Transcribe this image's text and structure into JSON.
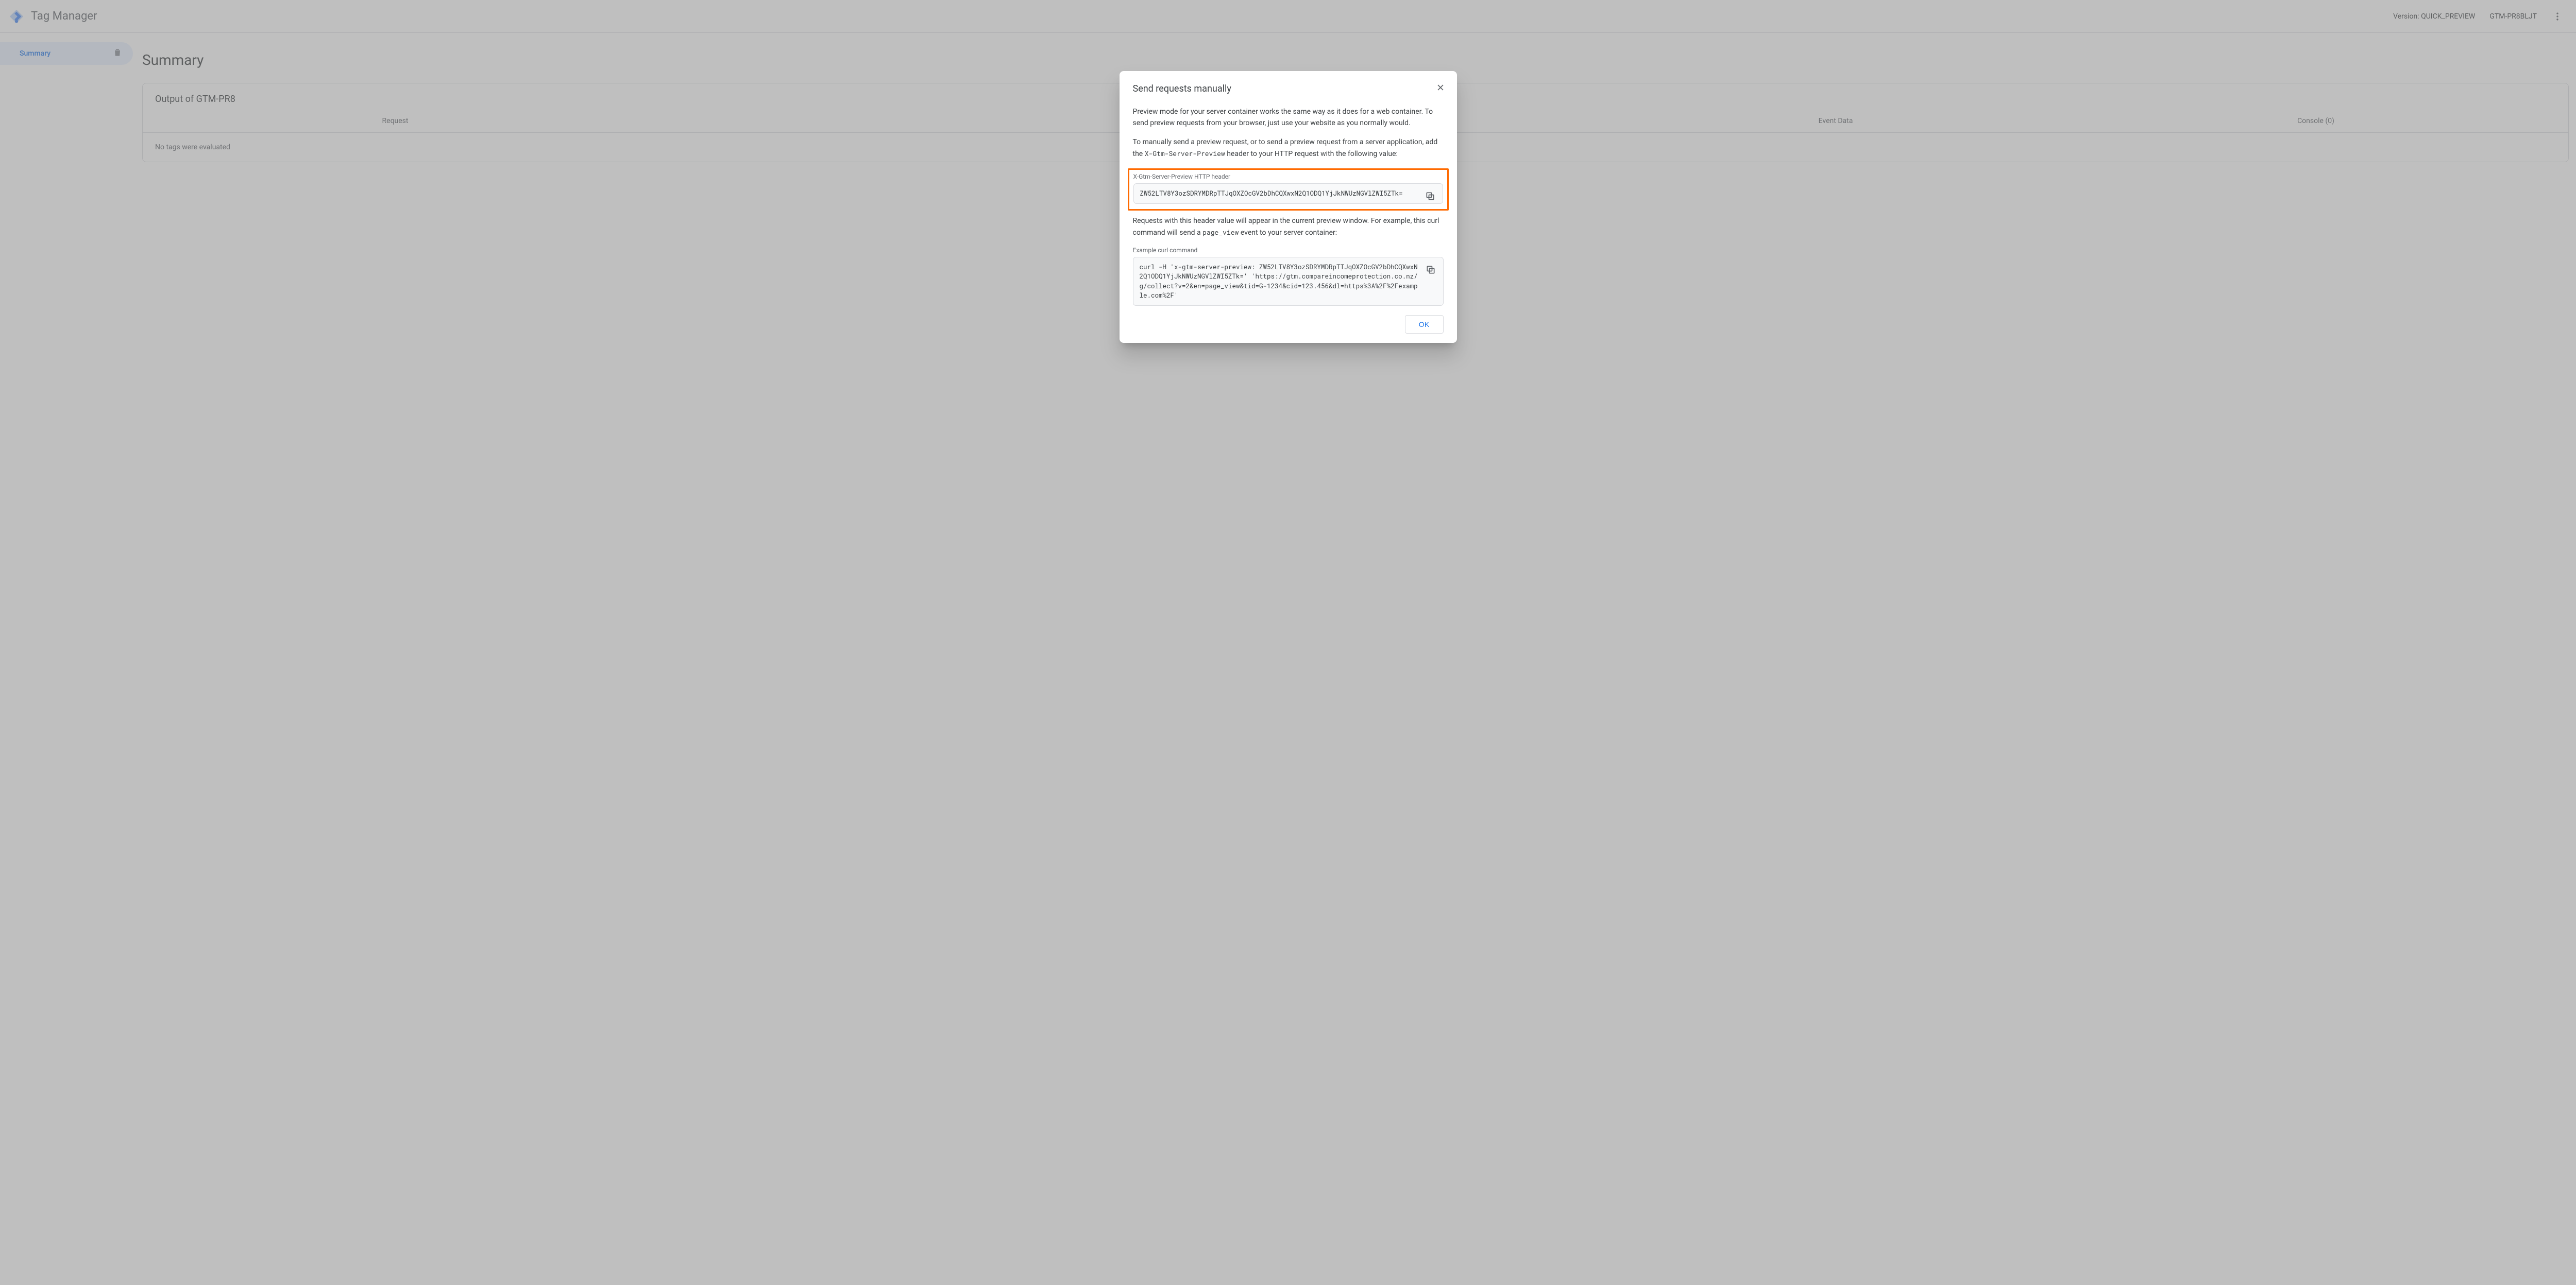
{
  "header": {
    "app_title": "Tag Manager",
    "version_label": "Version: QUICK_PREVIEW",
    "container_id": "GTM-PR8BLJT"
  },
  "sidebar": {
    "items": [
      {
        "label": "Summary"
      }
    ]
  },
  "main": {
    "page_title": "Summary",
    "output_heading": "Output of GTM-PR8",
    "tabs": [
      {
        "label": "Request"
      },
      {
        "label": "Event Data"
      },
      {
        "label": "Console (0)"
      }
    ],
    "body_text": "No tags were evaluated"
  },
  "modal": {
    "title": "Send requests manually",
    "para1": "Preview mode for your server container works the same way as it does for a web container. To send preview requests from your browser, just use your website as you normally would.",
    "para2_pre": "To manually send a preview request, or to send a preview request from a server application, add the ",
    "para2_code": "X-Gtm-Server-Preview",
    "para2_post": " header to your HTTP request with the following value:",
    "header_field_label": "X-Gtm-Server-Preview HTTP header",
    "header_field_value": "ZW52LTV8Y3ozSDRYMDRpTTJqOXZOcGV2bDhCQXwxN2Q1ODQ1YjJkNWUzNGVlZWI5ZTk=",
    "para3_pre": "Requests with this header value will appear in the current preview window. For example, this curl command will send a ",
    "para3_code": "page_view",
    "para3_post": " event to your server container:",
    "curl_field_label": "Example curl command",
    "curl_field_value": "curl -H 'x-gtm-server-preview: ZW52LTV8Y3ozSDRYMDRpTTJqOXZOcGV2bDhCQXwxN2Q1ODQ1YjJkNWUzNGVlZWI5ZTk=' 'https://gtm.compareincomeprotection.co.nz/g/collect?v=2&en=page_view&tid=G-1234&cid=123.456&dl=https%3A%2F%2Fexample.com%2F'",
    "ok_label": "OK"
  }
}
